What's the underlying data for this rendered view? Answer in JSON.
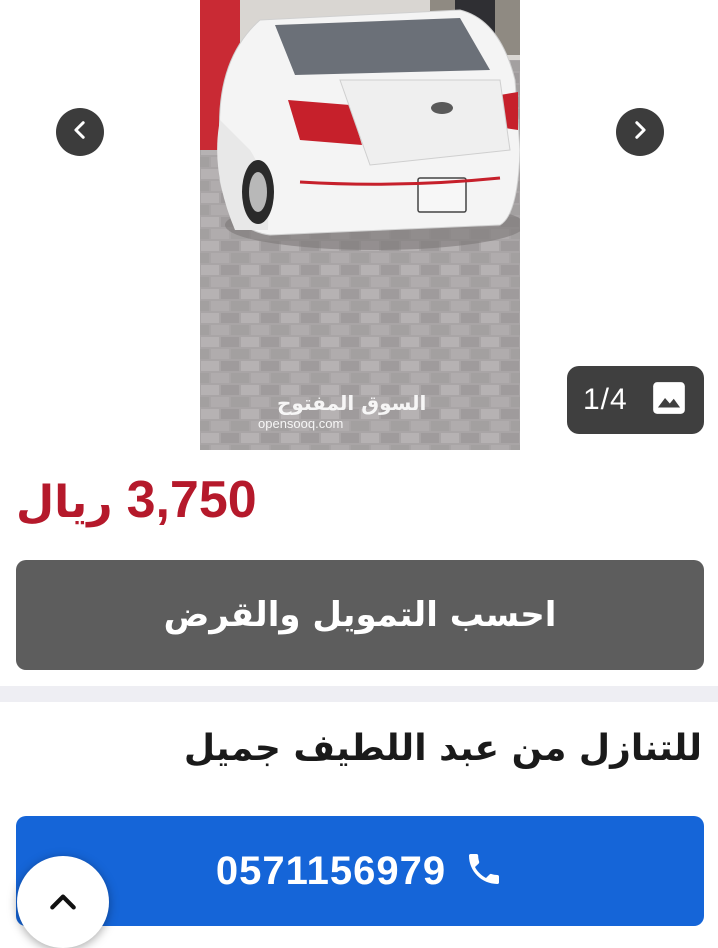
{
  "gallery": {
    "counter": "1/4",
    "photo_logo": {
      "watermark_ar": "السوق المفتوح",
      "watermark_en": "opensooq.com"
    },
    "icons": {
      "prev": "chevron-left-icon",
      "next": "chevron-right-icon",
      "gallery": "image-icon"
    }
  },
  "listing": {
    "price_value": "3,750",
    "price_currency": "ريال",
    "price_color": "#b5192b",
    "finance_button": "احسب التمويل والقرض",
    "seller_title": "للتنازل من عبد اللطيف جميل"
  },
  "call": {
    "phone": "0571156979",
    "button_color": "#1565d8",
    "icon": "phone-icon"
  },
  "scroll_top": {
    "icon": "chevron-up-icon"
  }
}
